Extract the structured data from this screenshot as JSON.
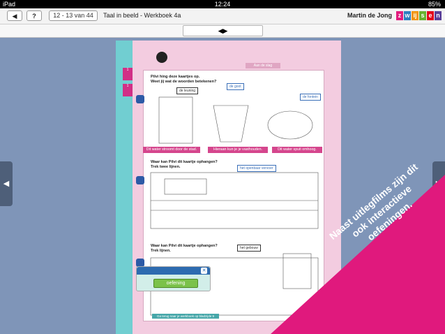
{
  "statusbar": {
    "device": "iPad",
    "time": "12:24",
    "battery": "85%"
  },
  "toolbar": {
    "back_label": "◀",
    "help_label": "?",
    "page_indicator": "12 - 13 van 44",
    "book_title": "Taal in beeld - Werkboek 4a",
    "user_name": "Martin de Jong",
    "logo_letters": [
      "z",
      "w",
      "ij",
      "s",
      "e",
      "n"
    ],
    "logo_colors": [
      "#e11c7e",
      "#2d7fc1",
      "#f29200",
      "#68b12f",
      "#e2001a",
      "#5a3f99"
    ]
  },
  "subbar": {
    "toggle_label": "◀▶"
  },
  "nav": {
    "prev_label": "◀",
    "next_label": "▶"
  },
  "workbook": {
    "header_tag": "Aan de slag",
    "ex1_title": "Pilvi hing deze kaartjes op.\nWeet jij wat de woorden betekenen?",
    "ex1_labels": [
      "de leuning",
      "de goot",
      "de fontein"
    ],
    "ex1_captions": [
      "Dit water stroomt door de stad.",
      "Hieraan kun je je vasthouden.",
      "Dit water spuit omhoog."
    ],
    "ex2_title": "Waar kan Pilvi dit kaartje ophangen?\nTrek twee lijnen.",
    "ex2_label": "het openbaar vervoer",
    "ex3_title": "Waar kan Pilvi dit kaartje ophangen?\nTrek lijnen.",
    "ex3_label": "het gebouw",
    "footer_text": "Ga terug naar je werkboek op bladzijde 9",
    "flags": [
      "1",
      "1"
    ]
  },
  "popup": {
    "button_label": "oefening",
    "close_label": "✕"
  },
  "banner": {
    "lines": [
      "Naast uitlegfilms zijn dit",
      "ook interactieve",
      "oefeningen."
    ],
    "color": "#e0197d"
  }
}
